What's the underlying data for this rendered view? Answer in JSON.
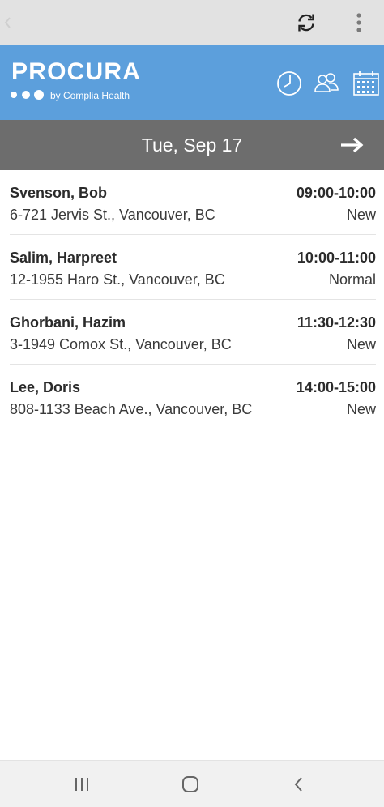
{
  "header": {
    "back_icon": "chevron-left-icon",
    "refresh_icon": "refresh-icon",
    "menu_icon": "kebab-menu-icon"
  },
  "brand": {
    "logo_title": "PROCURA",
    "logo_subtitle": "by Complia Health",
    "icons": [
      "clock-icon",
      "people-icon",
      "calendar-icon"
    ],
    "color": "#5c9fdc"
  },
  "date_bar": {
    "date": "Tue, Sep 17",
    "next_icon": "arrow-right-icon",
    "color": "#6d6d6d"
  },
  "visits": [
    {
      "name": "Svenson, Bob",
      "address": "6-721 Jervis St., Vancouver, BC",
      "time": "09:00-10:00",
      "status": "New"
    },
    {
      "name": "Salim, Harpreet",
      "address": "12-1955 Haro St., Vancouver, BC",
      "time": "10:00-11:00",
      "status": "Normal"
    },
    {
      "name": "Ghorbani, Hazim",
      "address": "3-1949 Comox St., Vancouver, BC",
      "time": "11:30-12:30",
      "status": "New"
    },
    {
      "name": "Lee, Doris",
      "address": "808-1133 Beach Ave., Vancouver, BC",
      "time": "14:00-15:00",
      "status": "New"
    }
  ],
  "nav": {
    "icons": [
      "recents-icon",
      "home-icon",
      "back-icon"
    ]
  }
}
